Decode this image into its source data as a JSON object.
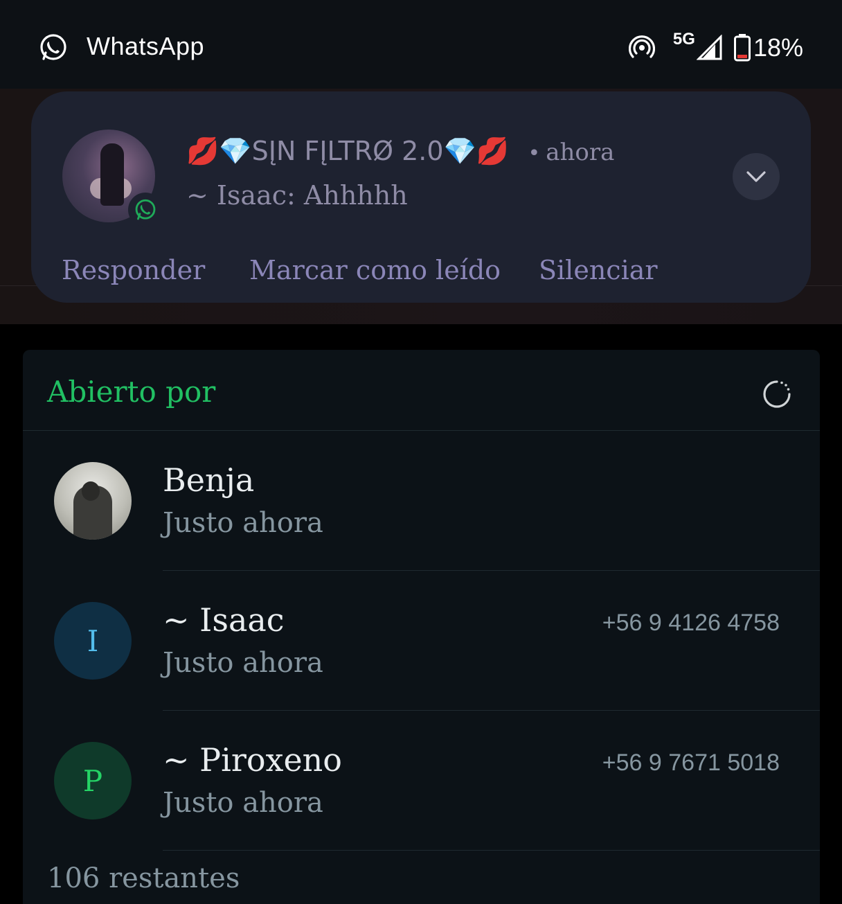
{
  "status_bar": {
    "app_name": "WhatsApp",
    "network": "5G",
    "battery": "18%"
  },
  "notification": {
    "title": "💋💎SĮN FĮLTRØ 2.0💎💋",
    "time": "ahora",
    "message": "~ Isaac: Ahhhhh",
    "actions": [
      "Responder",
      "Marcar como leído",
      "Silenciar"
    ]
  },
  "panel": {
    "title": "Abierto por",
    "rows": [
      {
        "name": "Benja",
        "status": "Justo ahora",
        "phone": "",
        "initial": ""
      },
      {
        "name": "~ Isaac",
        "status": "Justo ahora",
        "phone": "+56 9 4126 4758",
        "initial": "I"
      },
      {
        "name": "~ Piroxeno",
        "status": "Justo ahora",
        "phone": "+56 9 7671 5018",
        "initial": "P"
      }
    ],
    "remaining": "106 restantes"
  },
  "colors": {
    "accent_green": "#21c063",
    "isaac_avatar_bg": "#0f2f44",
    "isaac_avatar_fg": "#53bdeb",
    "piroxeno_avatar_bg": "#0f3a2a",
    "piroxeno_avatar_fg": "#25d366"
  }
}
